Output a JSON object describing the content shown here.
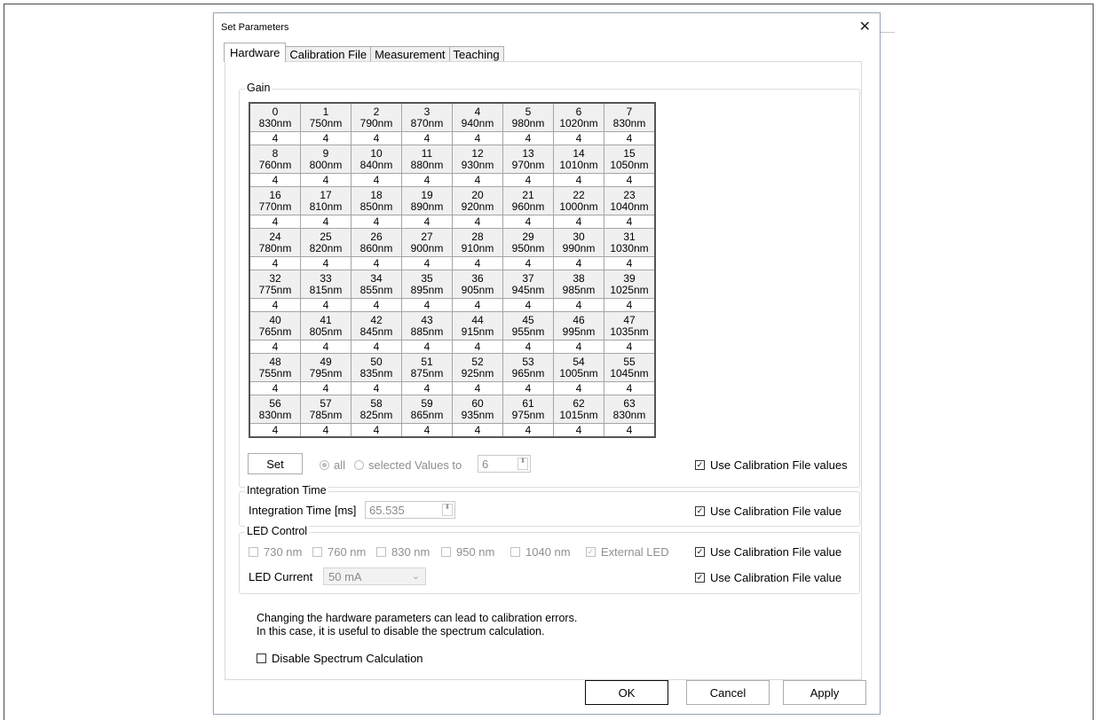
{
  "dialog": {
    "title": "Set Parameters",
    "close_glyph": "✕"
  },
  "tabs": [
    {
      "label": "Hardware",
      "active": true
    },
    {
      "label": "Calibration File",
      "active": false
    },
    {
      "label": "Measurement",
      "active": false
    },
    {
      "label": "Teaching",
      "active": false
    }
  ],
  "gain": {
    "legend": "Gain",
    "channels": [
      {
        "index": "0",
        "wavelength": "830nm",
        "value": "4"
      },
      {
        "index": "1",
        "wavelength": "750nm",
        "value": "4"
      },
      {
        "index": "2",
        "wavelength": "790nm",
        "value": "4"
      },
      {
        "index": "3",
        "wavelength": "870nm",
        "value": "4"
      },
      {
        "index": "4",
        "wavelength": "940nm",
        "value": "4"
      },
      {
        "index": "5",
        "wavelength": "980nm",
        "value": "4"
      },
      {
        "index": "6",
        "wavelength": "1020nm",
        "value": "4"
      },
      {
        "index": "7",
        "wavelength": "830nm",
        "value": "4"
      },
      {
        "index": "8",
        "wavelength": "760nm",
        "value": "4"
      },
      {
        "index": "9",
        "wavelength": "800nm",
        "value": "4"
      },
      {
        "index": "10",
        "wavelength": "840nm",
        "value": "4"
      },
      {
        "index": "11",
        "wavelength": "880nm",
        "value": "4"
      },
      {
        "index": "12",
        "wavelength": "930nm",
        "value": "4"
      },
      {
        "index": "13",
        "wavelength": "970nm",
        "value": "4"
      },
      {
        "index": "14",
        "wavelength": "1010nm",
        "value": "4"
      },
      {
        "index": "15",
        "wavelength": "1050nm",
        "value": "4"
      },
      {
        "index": "16",
        "wavelength": "770nm",
        "value": "4"
      },
      {
        "index": "17",
        "wavelength": "810nm",
        "value": "4"
      },
      {
        "index": "18",
        "wavelength": "850nm",
        "value": "4"
      },
      {
        "index": "19",
        "wavelength": "890nm",
        "value": "4"
      },
      {
        "index": "20",
        "wavelength": "920nm",
        "value": "4"
      },
      {
        "index": "21",
        "wavelength": "960nm",
        "value": "4"
      },
      {
        "index": "22",
        "wavelength": "1000nm",
        "value": "4"
      },
      {
        "index": "23",
        "wavelength": "1040nm",
        "value": "4"
      },
      {
        "index": "24",
        "wavelength": "780nm",
        "value": "4"
      },
      {
        "index": "25",
        "wavelength": "820nm",
        "value": "4"
      },
      {
        "index": "26",
        "wavelength": "860nm",
        "value": "4"
      },
      {
        "index": "27",
        "wavelength": "900nm",
        "value": "4"
      },
      {
        "index": "28",
        "wavelength": "910nm",
        "value": "4"
      },
      {
        "index": "29",
        "wavelength": "950nm",
        "value": "4"
      },
      {
        "index": "30",
        "wavelength": "990nm",
        "value": "4"
      },
      {
        "index": "31",
        "wavelength": "1030nm",
        "value": "4"
      },
      {
        "index": "32",
        "wavelength": "775nm",
        "value": "4"
      },
      {
        "index": "33",
        "wavelength": "815nm",
        "value": "4"
      },
      {
        "index": "34",
        "wavelength": "855nm",
        "value": "4"
      },
      {
        "index": "35",
        "wavelength": "895nm",
        "value": "4"
      },
      {
        "index": "36",
        "wavelength": "905nm",
        "value": "4"
      },
      {
        "index": "37",
        "wavelength": "945nm",
        "value": "4"
      },
      {
        "index": "38",
        "wavelength": "985nm",
        "value": "4"
      },
      {
        "index": "39",
        "wavelength": "1025nm",
        "value": "4"
      },
      {
        "index": "40",
        "wavelength": "765nm",
        "value": "4"
      },
      {
        "index": "41",
        "wavelength": "805nm",
        "value": "4"
      },
      {
        "index": "42",
        "wavelength": "845nm",
        "value": "4"
      },
      {
        "index": "43",
        "wavelength": "885nm",
        "value": "4"
      },
      {
        "index": "44",
        "wavelength": "915nm",
        "value": "4"
      },
      {
        "index": "45",
        "wavelength": "955nm",
        "value": "4"
      },
      {
        "index": "46",
        "wavelength": "995nm",
        "value": "4"
      },
      {
        "index": "47",
        "wavelength": "1035nm",
        "value": "4"
      },
      {
        "index": "48",
        "wavelength": "755nm",
        "value": "4"
      },
      {
        "index": "49",
        "wavelength": "795nm",
        "value": "4"
      },
      {
        "index": "50",
        "wavelength": "835nm",
        "value": "4"
      },
      {
        "index": "51",
        "wavelength": "875nm",
        "value": "4"
      },
      {
        "index": "52",
        "wavelength": "925nm",
        "value": "4"
      },
      {
        "index": "53",
        "wavelength": "965nm",
        "value": "4"
      },
      {
        "index": "54",
        "wavelength": "1005nm",
        "value": "4"
      },
      {
        "index": "55",
        "wavelength": "1045nm",
        "value": "4"
      },
      {
        "index": "56",
        "wavelength": "830nm",
        "value": "4"
      },
      {
        "index": "57",
        "wavelength": "785nm",
        "value": "4"
      },
      {
        "index": "58",
        "wavelength": "825nm",
        "value": "4"
      },
      {
        "index": "59",
        "wavelength": "865nm",
        "value": "4"
      },
      {
        "index": "60",
        "wavelength": "935nm",
        "value": "4"
      },
      {
        "index": "61",
        "wavelength": "975nm",
        "value": "4"
      },
      {
        "index": "62",
        "wavelength": "1015nm",
        "value": "4"
      },
      {
        "index": "63",
        "wavelength": "830nm",
        "value": "4"
      }
    ],
    "set_label": "Set",
    "radio_all": "all",
    "radio_selected": "selected Values to",
    "set_value": "6",
    "use_calibration": "Use Calibration File values",
    "use_calibration_checked": true
  },
  "integration": {
    "legend": "Integration Time",
    "label": "Integration Time [ms]",
    "value": "65.535",
    "use_calibration": "Use Calibration File value"
  },
  "led": {
    "legend": "LED Control",
    "options": [
      {
        "label": "730 nm",
        "checked": false
      },
      {
        "label": "760 nm",
        "checked": false
      },
      {
        "label": "830 nm",
        "checked": false
      },
      {
        "label": "950 nm",
        "checked": false
      },
      {
        "label": "1040 nm",
        "checked": false
      },
      {
        "label": "External LED",
        "checked": true
      }
    ],
    "use_calibration": "Use Calibration File value",
    "current_label": "LED Current",
    "current_value": "50 mA",
    "use_calibration_current": "Use Calibration File value"
  },
  "notes": {
    "line1": "Changing the hardware parameters can lead to calibration errors.",
    "line2": "In this case, it is useful to disable the spectrum calculation.",
    "disable_label": "Disable Spectrum Calculation"
  },
  "buttons": {
    "ok": "OK",
    "cancel": "Cancel",
    "apply": "Apply"
  },
  "glyphs": {
    "check": "✓",
    "spin": "⬍",
    "dropdown": "⌄"
  }
}
